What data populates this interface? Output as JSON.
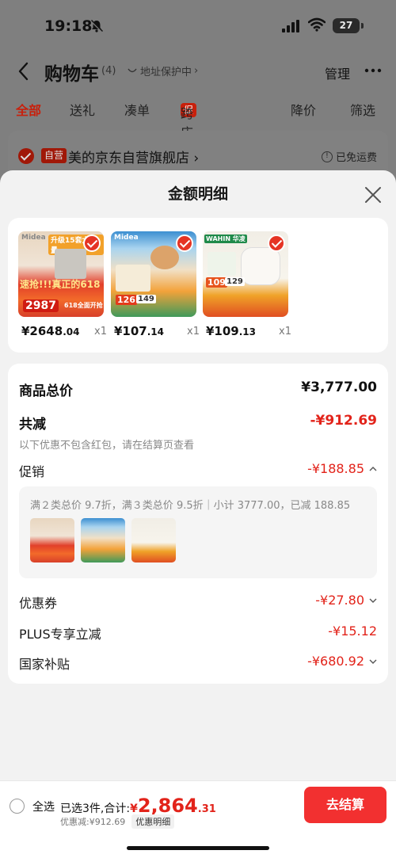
{
  "status": {
    "time": "19:18",
    "battery": "27"
  },
  "cart": {
    "back_icon": "chevron-left-icon",
    "title": "购物车",
    "count": "(4)",
    "address_protect": "地址保护中",
    "manage": "管理",
    "tabs": [
      "全部",
      "送礼",
      "凑单",
      "跨店满减",
      "降价",
      "筛选"
    ],
    "promo_badge": "促",
    "store": {
      "badge": "自营",
      "name": "美的京东自营旗舰店",
      "shipping": "已免运费"
    }
  },
  "sheet": {
    "title": "金额明细",
    "products": [
      {
        "price_int": "¥2648",
        "price_dec": ".04",
        "qty": "x1",
        "art": {
          "brand": "Midea",
          "headline": "升级15套大容量",
          "promo": "速抢!!!真正的618",
          "price": "2987",
          "tag": "618全面开抢"
        }
      },
      {
        "price_int": "¥107",
        "price_dec": ".14",
        "qty": "x1",
        "art": {
          "brand": "Midea",
          "price": "126",
          "price2": "149"
        }
      },
      {
        "price_int": "¥109",
        "price_dec": ".13",
        "qty": "x1",
        "art": {
          "brand": "WAHIN 华凌",
          "price": "109",
          "price2": "129"
        }
      }
    ],
    "total_label": "商品总价",
    "total_value": "¥3,777.00",
    "reduce_label": "共减",
    "reduce_value": "-¥912.69",
    "reduce_note": "以下优惠不包含红包，请在结算页查看",
    "promo_label": "促销",
    "promo_value": "-¥188.85",
    "promo_detail": "满２类总价 9.7折，满３类总价 9.5折｜小计 3777.00，已减 188.85",
    "coupon_label": "优惠券",
    "coupon_value": "-¥27.80",
    "plus_label": "PLUS专享立减",
    "plus_value": "-¥15.12",
    "subsidy_label": "国家补贴",
    "subsidy_value": "-¥680.92"
  },
  "bottom": {
    "select_all": "全选",
    "selected_text": "已选3件,合计:",
    "total_yen": "¥",
    "total_int": "2,864",
    "total_dec": ".31",
    "saved": "优惠减:¥912.69",
    "detail_link": "优惠明细",
    "checkout": "去结算"
  },
  "colors": {
    "accent": "#e2231a",
    "checkout": "#f23030"
  }
}
